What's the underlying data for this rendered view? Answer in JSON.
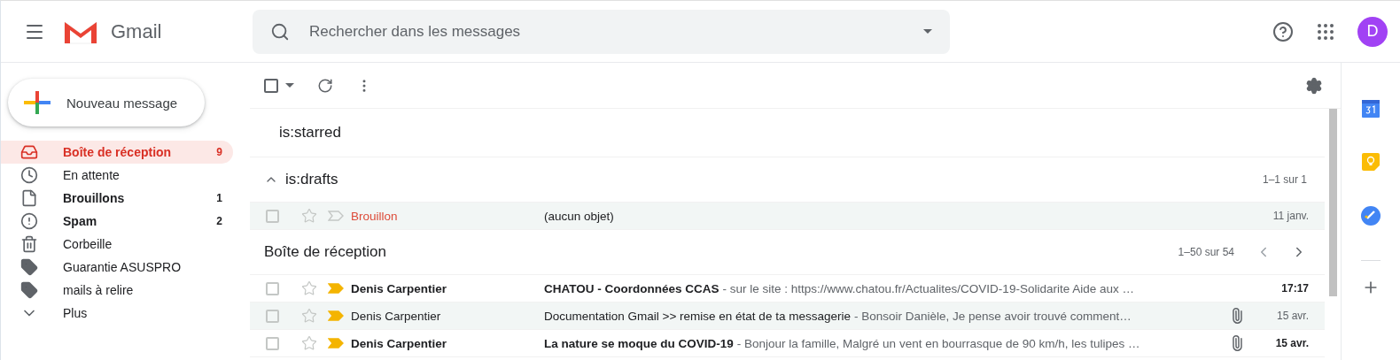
{
  "header": {
    "app_name": "Gmail",
    "search": {
      "placeholder": "Rechercher dans les messages"
    },
    "avatar": "D"
  },
  "compose": {
    "label": "Nouveau message"
  },
  "sidebar": {
    "items": [
      {
        "label": "Boîte de réception",
        "count": "9",
        "bold": true,
        "selected": true
      },
      {
        "label": "En attente",
        "bold": false,
        "selected": false
      },
      {
        "label": "Brouillons",
        "count": "1",
        "bold": true,
        "selected": false
      },
      {
        "label": "Spam",
        "count": "2",
        "bold": true,
        "selected": false
      },
      {
        "label": "Corbeille",
        "bold": false,
        "selected": false
      },
      {
        "label": "Guarantie ASUSPRO",
        "bold": false,
        "selected": false
      },
      {
        "label": "mails à relire",
        "bold": false,
        "selected": false
      },
      {
        "label": "Plus",
        "bold": false,
        "selected": false
      }
    ]
  },
  "toolbar": {
    "select_all": {
      "checked": false
    }
  },
  "sections": [
    {
      "title": "is:starred"
    },
    {
      "title": "is:drafts",
      "expanded": true,
      "range": "1–1 sur 1",
      "rows": [
        {
          "kind": "draft",
          "sender": "Brouillon",
          "subject": "(aucun objet)",
          "date": "11 janv.",
          "unread": false,
          "checked": false,
          "starred": false,
          "important": false,
          "attachment": false
        }
      ]
    },
    {
      "title": "Boîte de réception",
      "range": "1–50 sur 54",
      "pager": true,
      "rows": [
        {
          "kind": "mail",
          "sender": "Denis Carpentier",
          "subject": "CHATOU - Coordonnées CCAS",
          "snippet": "- sur le site : https://www.chatou.fr/Actualites/COVID-19-Solidarite Aide aux …",
          "date": "17:17",
          "unread": true,
          "checked": false,
          "starred": false,
          "important": true,
          "attachment": false
        },
        {
          "kind": "mail",
          "sender": "Denis Carpentier",
          "subject": "Documentation Gmail >> remise en état de ta messagerie",
          "snippet": "- Bonsoir Danièle, Je pense avoir trouvé comment…",
          "date": "15 avr.",
          "unread": false,
          "checked": false,
          "starred": false,
          "important": true,
          "attachment": true
        },
        {
          "kind": "mail",
          "sender": "Denis Carpentier",
          "subject": "La nature se moque du COVID-19",
          "snippet": "- Bonjour la famille, Malgré un vent en bourrasque de 90 km/h, les tulipes …",
          "date": "15 avr.",
          "unread": true,
          "checked": false,
          "starred": false,
          "important": true,
          "attachment": true
        }
      ]
    }
  ]
}
